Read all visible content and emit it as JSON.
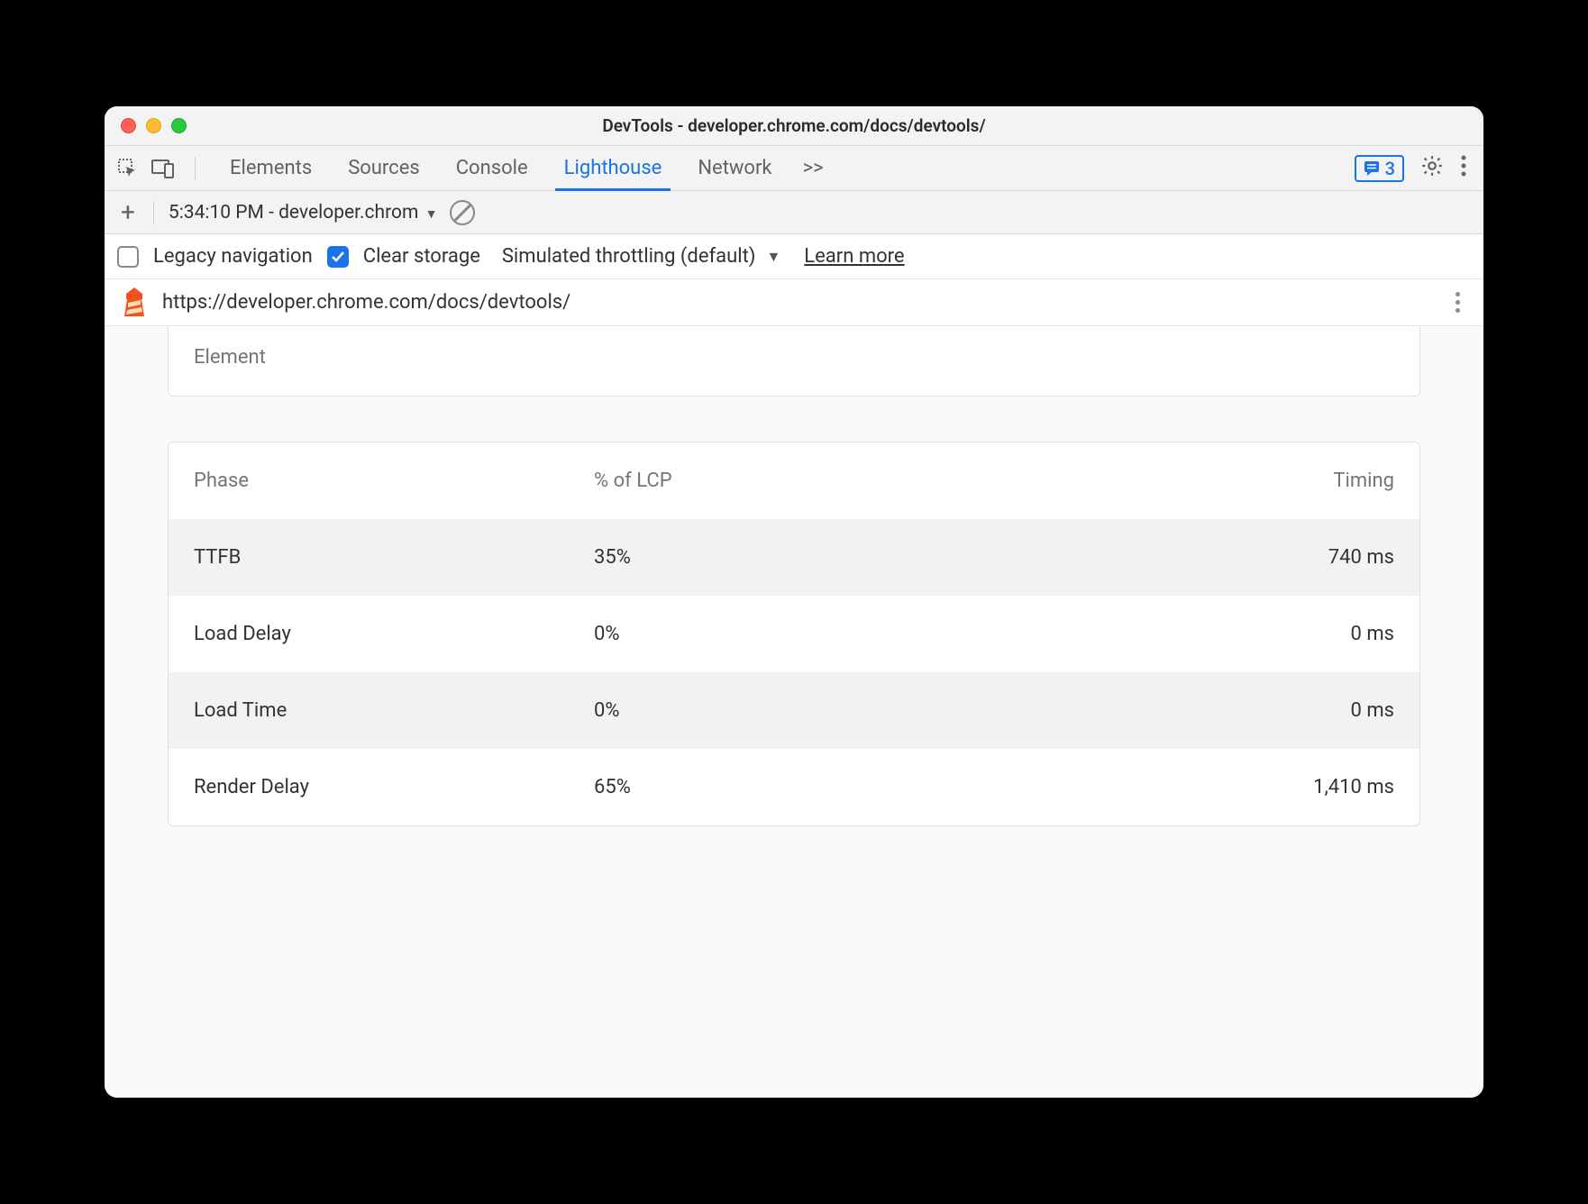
{
  "titlebar": {
    "title": "DevTools - developer.chrome.com/docs/devtools/"
  },
  "tabs": {
    "items": [
      "Elements",
      "Sources",
      "Console",
      "Lighthouse",
      "Network"
    ],
    "active_index": 3,
    "overflow_glyph": ">>",
    "badge_count": "3"
  },
  "subbar": {
    "report_label": "5:34:10 PM - developer.chrom"
  },
  "options": {
    "legacy_nav_label": "Legacy navigation",
    "legacy_nav_checked": false,
    "clear_storage_label": "Clear storage",
    "clear_storage_checked": true,
    "throttling_label": "Simulated throttling (default)",
    "learn_more_label": "Learn more"
  },
  "url_row": {
    "url": "https://developer.chrome.com/docs/devtools/"
  },
  "element_card": {
    "label": "Element"
  },
  "table": {
    "columns": [
      "Phase",
      "% of LCP",
      "Timing"
    ],
    "rows": [
      {
        "phase": "TTFB",
        "pct": "35%",
        "timing": "740 ms"
      },
      {
        "phase": "Load Delay",
        "pct": "0%",
        "timing": "0 ms"
      },
      {
        "phase": "Load Time",
        "pct": "0%",
        "timing": "0 ms"
      },
      {
        "phase": "Render Delay",
        "pct": "65%",
        "timing": "1,410 ms"
      }
    ]
  }
}
